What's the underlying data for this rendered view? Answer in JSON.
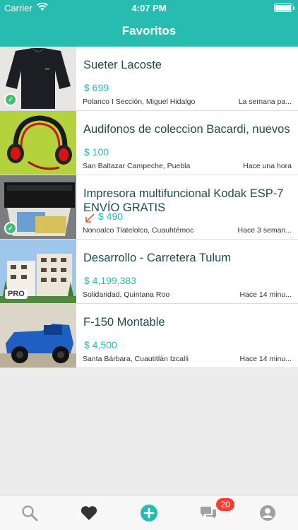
{
  "status_bar": {
    "carrier": "Carrier",
    "time": "4:07 PM"
  },
  "header": {
    "title": "Favoritos"
  },
  "items": [
    {
      "title": "Sueter Lacoste",
      "price": "$ 699",
      "location": "Polanco I Sección, Miguel Hidalgo",
      "time": "La semana pa...",
      "badge": "certified"
    },
    {
      "title": "Audifonos de coleccion Bacardi, nuevos",
      "price": "$ 100",
      "location": "San Baltazar Campeche, Puebla",
      "time": "Hace una hora",
      "badge": ""
    },
    {
      "title": "Impresora multifuncional Kodak ESP-7 ENVÍO GRATIS",
      "price": "$ 490",
      "location": "Nonoalco Tlatelolco, Cuauhtémoc",
      "time": "Hace 3 seman...",
      "badge": "certified",
      "price_drop": true
    },
    {
      "title": "Desarrollo -  Carretera Tulum",
      "price": "$ 4,199,383",
      "location": "Solidaridad, Quintana Roo",
      "time": "Hace 14 minu...",
      "badge": "PRO"
    },
    {
      "title": "F-150 Montable",
      "price": "$ 4,500",
      "location": "Santa Bárbara, Cuautitlán Izcalli",
      "time": "Hace 14 minu...",
      "badge": ""
    }
  ],
  "tabbar": {
    "tabs": [
      {
        "icon": "search-icon"
      },
      {
        "icon": "heart-icon",
        "active": true
      },
      {
        "icon": "add-icon"
      },
      {
        "icon": "chat-icon",
        "badge": "20"
      },
      {
        "icon": "profile-icon"
      }
    ]
  },
  "colors": {
    "accent": "#26bcb0",
    "title_text": "#1e4b4c",
    "badge_red": "#ff3b30",
    "tab_active": "#333333",
    "tab_inactive": "#a0a0a0"
  }
}
